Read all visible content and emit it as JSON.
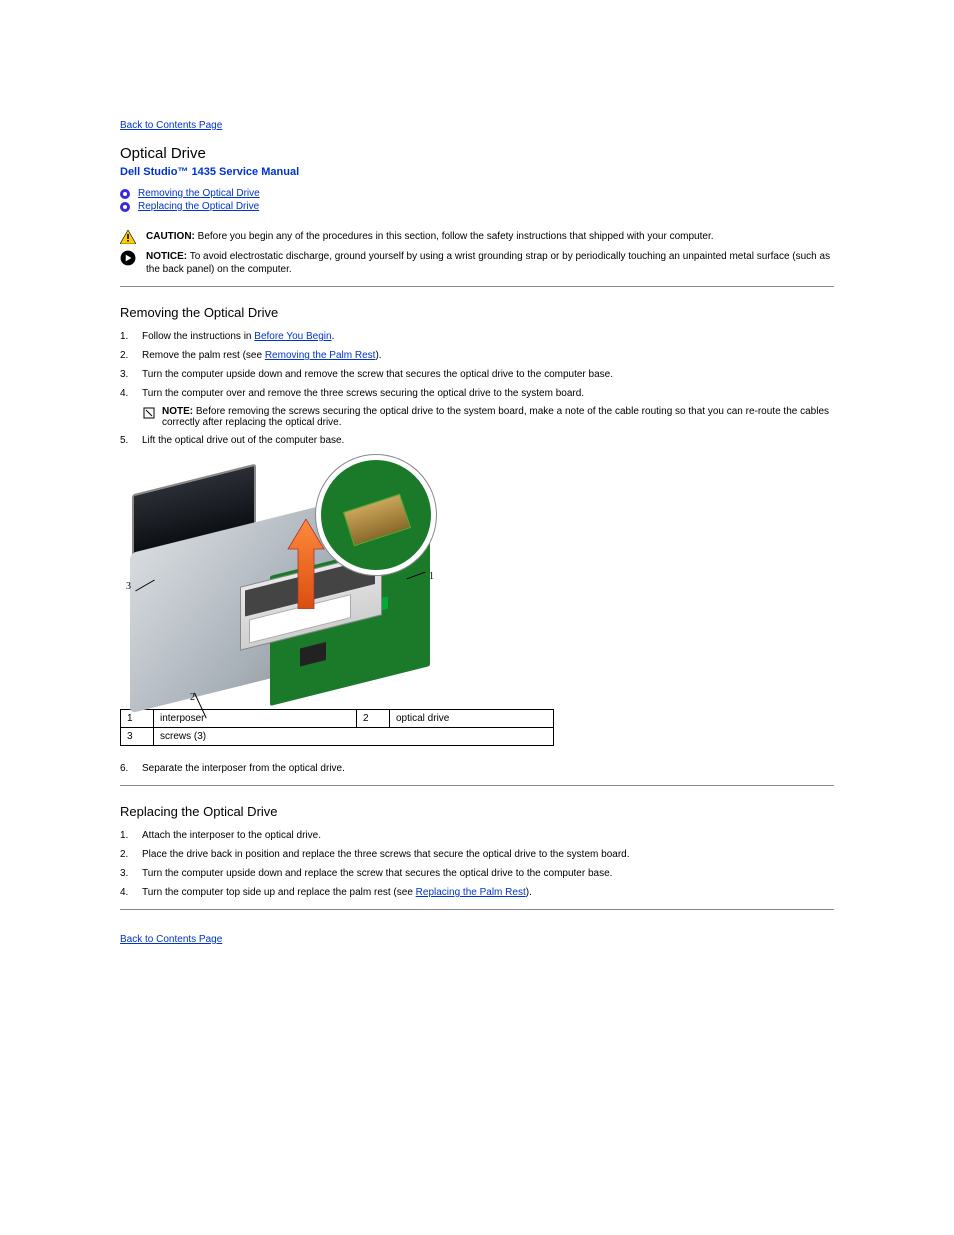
{
  "nav": {
    "back_top": "Back to Contents Page",
    "back_bottom": "Back to Contents Page"
  },
  "title": "Optical Drive",
  "manual_title": "Dell Studio™ 1435 Service Manual",
  "toc": [
    {
      "label": "Removing the Optical Drive"
    },
    {
      "label": "Replacing the Optical Drive"
    }
  ],
  "caution": {
    "label": "CAUTION:",
    "text": "Before you begin any of the procedures in this section, follow the safety instructions that shipped with your computer."
  },
  "notice": {
    "label": "NOTICE:",
    "text": "To avoid electrostatic discharge, ground yourself by using a wrist grounding strap or by periodically touching an unpainted metal surface (such as the back panel) on the computer."
  },
  "remove": {
    "heading": "Removing the Optical Drive",
    "steps": [
      {
        "num": "1.",
        "text_before": "Follow the instructions in ",
        "link": "Before You Begin",
        "text_after": "."
      },
      {
        "num": "2.",
        "text_before": "Remove the palm rest (see ",
        "link": "Removing the Palm Rest",
        "text_after": ")."
      },
      {
        "num": "3.",
        "text_before": "Turn the computer upside down and remove the screw that secures the optical drive to the computer base.",
        "link": "",
        "text_after": ""
      },
      {
        "num": "4.",
        "text_before": "Turn the computer over and remove the three screws securing the optical drive to the system board.",
        "note_label": "NOTE:",
        "note_text": "Before removing the screws securing the optical drive to the system board, make a note of the cable routing so that you can re-route the cables correctly after replacing the optical drive.",
        "link": "",
        "text_after": ""
      },
      {
        "num": "5.",
        "text_before": "Lift the optical drive out of the computer base.",
        "link": "",
        "text_after": ""
      }
    ]
  },
  "figure": {
    "callouts": [
      {
        "num": "1",
        "label": "interposer"
      },
      {
        "num": "2",
        "label": "optical drive"
      },
      {
        "num": "3",
        "label": "screws (3)"
      }
    ]
  },
  "table": {
    "r1c1n": "1",
    "r1c1t": "interposer",
    "r1c2n": "2",
    "r1c2t": "optical drive",
    "r2c1n": "3",
    "r2c1t": "screws (3)"
  },
  "poststeps": [
    {
      "num": "6.",
      "text": "Separate the interposer from the optical drive."
    }
  ],
  "replace": {
    "heading": "Replacing the Optical Drive",
    "steps": [
      {
        "num": "1.",
        "text": "Attach the interposer to the optical drive."
      },
      {
        "num": "2.",
        "text": "Place the drive back in position and replace the three screws that secure the optical drive to the system board."
      },
      {
        "num": "3.",
        "text": "Turn the computer upside down and replace the screw that secures the optical drive to the computer base."
      },
      {
        "num": "4.",
        "text_before": "Turn the computer top side up and replace the palm rest (see ",
        "link": "Replacing the Palm Rest",
        "text_after": ")."
      }
    ]
  }
}
